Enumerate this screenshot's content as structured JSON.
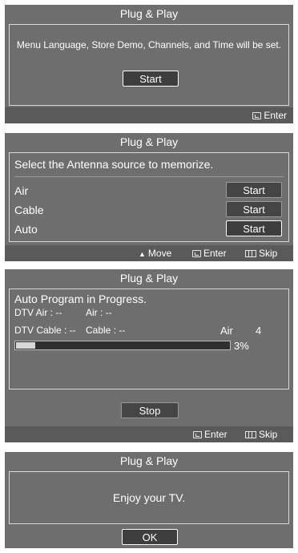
{
  "screen1": {
    "title": "Plug & Play",
    "message": "Menu Language, Store Demo, Channels, and Time will be set.",
    "start_button": "Start",
    "footer": {
      "enter": "Enter"
    }
  },
  "screen2": {
    "title": "Plug & Play",
    "heading": "Select the Antenna source to memorize.",
    "rows": [
      {
        "label": "Air",
        "button": "Start"
      },
      {
        "label": "Cable",
        "button": "Start"
      },
      {
        "label": "Auto",
        "button": "Start"
      }
    ],
    "footer": {
      "move": "Move",
      "enter": "Enter",
      "skip": "Skip"
    }
  },
  "screen3": {
    "title": "Plug & Play",
    "heading": "Auto Program in Progress.",
    "dtv_air": "DTV Air : --",
    "air": "Air : --",
    "dtv_cable": "DTV Cable : --",
    "cable": "Cable : --",
    "source_label": "Air",
    "channel": "4",
    "progress_percent": "3%",
    "progress_value": 0.03,
    "stop_button": "Stop",
    "footer": {
      "enter": "Enter",
      "skip": "Skip"
    }
  },
  "screen4": {
    "title": "Plug & Play",
    "message": "Enjoy your TV.",
    "ok_button": "OK"
  }
}
